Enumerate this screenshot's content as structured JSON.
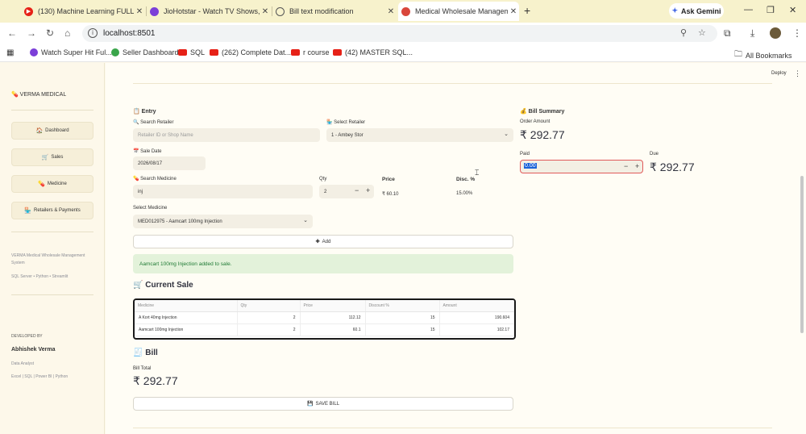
{
  "browser": {
    "tabs": [
      {
        "title": "(130) Machine Learning FULL C",
        "favicon_color": "#e62117"
      },
      {
        "title": "JioHotstar - Watch TV Shows, M",
        "favicon_color": "#7b3fd8"
      },
      {
        "title": "Bill text modification",
        "favicon_color": "#555555"
      },
      {
        "title": "Medical Wholesale Managem",
        "favicon_color": "#d9463b"
      }
    ],
    "new_tab": "+",
    "ask_gemini": "Ask Gemini",
    "url": "localhost:8501",
    "bookmarks": [
      {
        "label": "Watch Super Hit Ful...",
        "color": "#7b3fd8"
      },
      {
        "label": "Seller Dashboard",
        "color": "#3aa54b"
      },
      {
        "label": "SQL",
        "color": "#e62117"
      },
      {
        "label": "(262) Complete Dat...",
        "color": "#e62117"
      },
      {
        "label": "r course",
        "color": "#e62117"
      },
      {
        "label": "(42) MASTER SQL...",
        "color": "#e62117"
      }
    ],
    "all_bookmarks": "All Bookmarks"
  },
  "header": {
    "deploy": "Deploy",
    "menu": "⋮"
  },
  "sidebar": {
    "brand": "VERMA MEDICAL",
    "nav": [
      {
        "label": "Dashboard",
        "icon": "🏠"
      },
      {
        "label": "Sales",
        "icon": "🛒"
      },
      {
        "label": "Medicine",
        "icon": "💊"
      },
      {
        "label": "Retailers & Payments",
        "icon": "🏪"
      }
    ],
    "about_line1": "VERMA Medical Wholesale Management System",
    "about_line2": "SQL Server • Python • Streamlit",
    "developed_by": "DEVELOPED BY",
    "dev_name": "Abhishek Verma",
    "dev_role": "Data Analyst",
    "dev_skills": "Excel | SQL | Power BI | Python"
  },
  "entry": {
    "title": "Entry",
    "search_retailer_label": "Search Retailer",
    "search_retailer_placeholder": "Retailer ID or Shop Name",
    "select_retailer_label": "Select Retailer",
    "select_retailer_value": "1 - Ambey Stor",
    "sale_date_label": "Sale Date",
    "sale_date_value": "2026/08/17",
    "search_medicine_label": "Search Medicine",
    "search_medicine_value": "inj",
    "qty_label": "Qty",
    "qty_value": "2",
    "price_label": "Price",
    "price_value": "₹ 60.10",
    "disc_label": "Disc. %",
    "disc_value": "15.00%",
    "select_medicine_label": "Select Medicine",
    "select_medicine_value": "MED012975 - Aamcart 100mg Injection",
    "add_button": "Add",
    "success_message": "Aamcart 100mg Injection added to sale."
  },
  "summary": {
    "title": "Bill Summary",
    "order_amount_label": "Order Amount",
    "order_amount": "₹ 292.77",
    "paid_label": "Paid",
    "paid_value": "0.00",
    "due_label": "Due",
    "due_value": "₹ 292.77"
  },
  "current_sale": {
    "title": "Current Sale",
    "columns": [
      "Medicine",
      "Qty",
      "Price",
      "Discount %",
      "Amount"
    ],
    "rows": [
      [
        "A Kort 40mg Injection",
        "2",
        "112.12",
        "15",
        "190.604"
      ],
      [
        "Aamcart 100mg Injection",
        "2",
        "60.1",
        "15",
        "102.17"
      ]
    ]
  },
  "bill": {
    "title": "Bill",
    "total_label": "Bill Total",
    "total_value": "₹ 292.77",
    "save_button": "SAVE BILL"
  }
}
